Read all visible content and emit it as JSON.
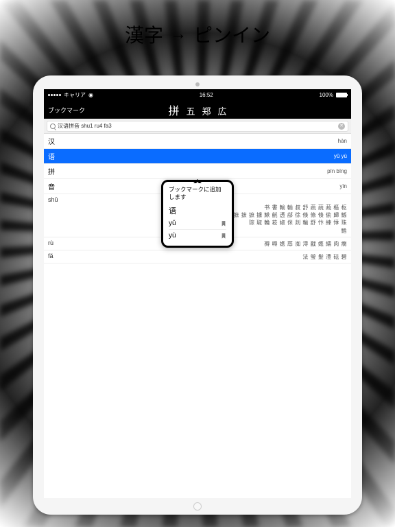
{
  "banner": {
    "left": "漢字",
    "arrow": "→",
    "right": "ピンイン"
  },
  "status": {
    "carrier": "キャリア",
    "wifi": "᯾",
    "time": "16:52",
    "battery_pct": "100%"
  },
  "nav": {
    "back": "ブックマーク",
    "tabs": [
      "拼",
      "五",
      "郑",
      "広"
    ],
    "active_index": 0
  },
  "search": {
    "value": "汉语拼音 shu1 ru4 fa3"
  },
  "rows": [
    {
      "char": "汉",
      "pinyin": "hàn",
      "selected": false
    },
    {
      "char": "语",
      "pinyin": "yǔ yù",
      "selected": true
    },
    {
      "char": "拼",
      "pinyin": "pīn bīng",
      "selected": false
    },
    {
      "char": "音",
      "pinyin": "yīn",
      "selected": false
    }
  ],
  "char_rows": [
    {
      "pinyin": "shū",
      "chars": "书 書 輸 輸 叔 舒 蔬 蔬 蔬 樞 枢\n姝 鯊 鯑 朱 忭 怸 杼 捄 摵 摭 摭 摭 擄 鰍 毹 透 鄃 徐 倏 條 倏 偷 歸 鯀\n琮 琡 輪 菘 婌 侎 剡 輸 舒 忭 練 悸 珠\n鯦"
    },
    {
      "pinyin": "rù",
      "chars": "褥 嗕 嫕 蓐 洳 淂 戤 嫕 繻 肉 瘸"
    },
    {
      "pinyin": "fǎ",
      "chars": "法 瑩 髮 澧 砝 碧"
    }
  ],
  "popup": {
    "title": "ブックマークに追加します",
    "char": "语",
    "items": [
      "yǔ",
      "yù"
    ]
  }
}
